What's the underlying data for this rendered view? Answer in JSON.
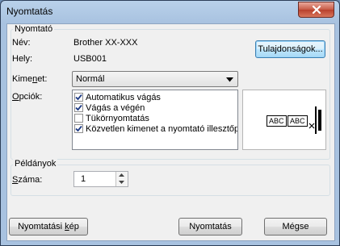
{
  "window": {
    "title": "Nyomtatás"
  },
  "printer_group": {
    "label": "Nyomtató",
    "name_label": "Név:",
    "name_value": "Brother XX-XXX",
    "location_label": "Hely:",
    "location_value": "USB001",
    "properties_button": "Tulajdonságok..."
  },
  "output": {
    "label_pre": "Kime",
    "label_key": "n",
    "label_post": "et:",
    "selected": "Normál"
  },
  "options": {
    "label_key": "O",
    "label_post": "pciók:",
    "items": [
      {
        "label": "Automatikus vágás",
        "checked": true
      },
      {
        "label": "Vágás a végén",
        "checked": true
      },
      {
        "label": "Tükörnyomtatás",
        "checked": false
      },
      {
        "label": "Közvetlen kimenet a nyomtató illesztőp",
        "checked": true
      }
    ]
  },
  "preview": {
    "tag1": "ABC",
    "tag2": "ABC"
  },
  "copies_group": {
    "label": "Példányok",
    "count_label_key": "S",
    "count_label_post": "záma:",
    "count_value": "1"
  },
  "buttons": {
    "preview_pre": "Nyomtatási ",
    "preview_key": "k",
    "preview_post": "ép",
    "print": "Nyomtatás",
    "cancel": "Mégse"
  }
}
